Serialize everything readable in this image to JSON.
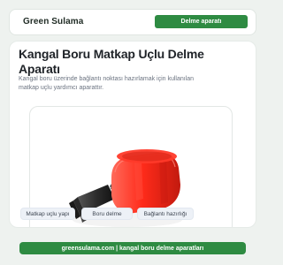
{
  "header": {
    "brand": "Green Sulama",
    "nav_button": "Delme aparatı"
  },
  "hero": {
    "title": "Kangal Boru Matkap Uçlu Delme Aparatı",
    "description": "Kangal boru üzerinde bağlantı noktası hazırlamak için kullanılan matkap uçlu yardımcı aparattır."
  },
  "tags": [
    "Matkap uçlu yapı",
    "Boru delme",
    "Bağlantı hazırlığı"
  ],
  "footer": {
    "text": "greensulama.com | kangal boru delme aparatları"
  },
  "colors": {
    "brand_green": "#2e8b42",
    "product_red": "#ff2b1a",
    "product_black": "#1f1f1f"
  }
}
